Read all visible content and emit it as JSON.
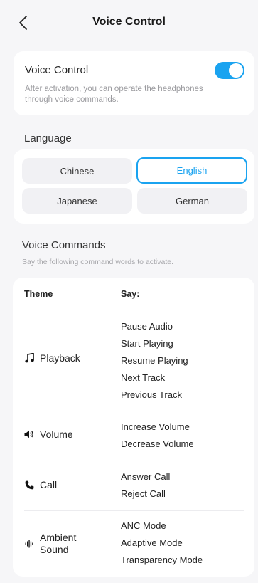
{
  "header": {
    "title": "Voice Control",
    "back_icon": "chevron-left-icon"
  },
  "voice_control": {
    "label": "Voice Control",
    "description": "After activation, you can operate the headphones through voice commands.",
    "enabled": true,
    "accent": "#1aa3f0"
  },
  "language": {
    "label": "Language",
    "options": [
      "Chinese",
      "English",
      "Japanese",
      "German"
    ],
    "selected": "English"
  },
  "commands": {
    "label": "Voice Commands",
    "subtitle": "Say the following command words to activate.",
    "col_theme": "Theme",
    "col_say": "Say:",
    "rows": [
      {
        "theme": "Playback",
        "icon": "music-note-icon",
        "say": [
          "Pause Audio",
          "Start Playing",
          "Resume Playing",
          "Next Track",
          "Previous Track"
        ]
      },
      {
        "theme": "Volume",
        "icon": "speaker-icon",
        "say": [
          "Increase Volume",
          "Decrease Volume"
        ]
      },
      {
        "theme": "Call",
        "icon": "phone-icon",
        "say": [
          "Answer Call",
          "Reject Call"
        ]
      },
      {
        "theme": "Ambient Sound",
        "icon": "soundwave-icon",
        "say": [
          "ANC Mode",
          "Adaptive Mode",
          "Transparency Mode"
        ]
      }
    ]
  }
}
